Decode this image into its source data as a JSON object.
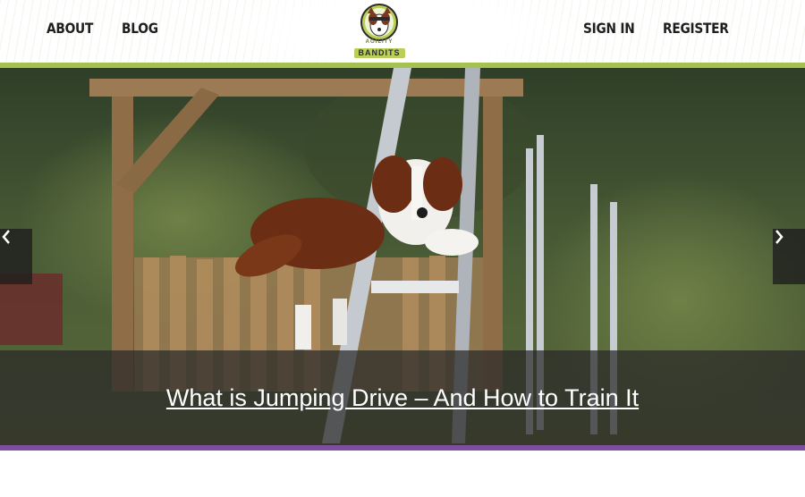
{
  "header": {
    "nav_left": [
      "ABOUT",
      "BLOG"
    ],
    "nav_right": [
      "SIGN IN",
      "REGISTER"
    ],
    "logo": {
      "small_text": "AGILITY",
      "big_text": "BANDITS"
    }
  },
  "hero": {
    "caption": "What is Jumping Drive – And How to Train It",
    "prev_icon": "chevron-left-icon",
    "next_icon": "chevron-right-icon"
  },
  "colors": {
    "accent_green": "#a5c251",
    "accent_purple": "#7f4d9e",
    "nav_text": "#1f1f1f"
  }
}
